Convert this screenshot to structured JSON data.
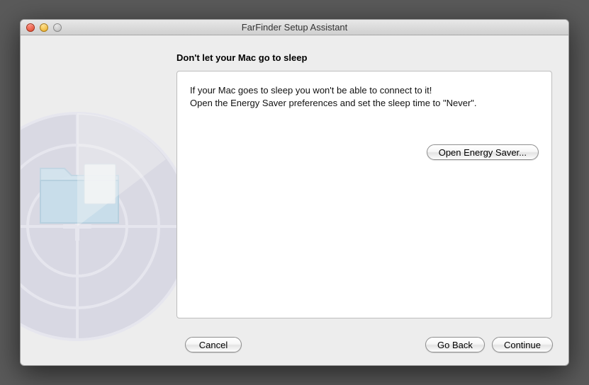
{
  "window": {
    "title": "FarFinder Setup Assistant"
  },
  "page": {
    "heading": "Don't let your Mac go to sleep",
    "body_line1": "If your Mac goes to sleep you won't be able to connect to it!",
    "body_line2": "Open the Energy Saver preferences and set the sleep time to \"Never\".",
    "open_energy_saver_label": "Open Energy Saver..."
  },
  "footer": {
    "cancel_label": "Cancel",
    "go_back_label": "Go Back",
    "continue_label": "Continue"
  }
}
